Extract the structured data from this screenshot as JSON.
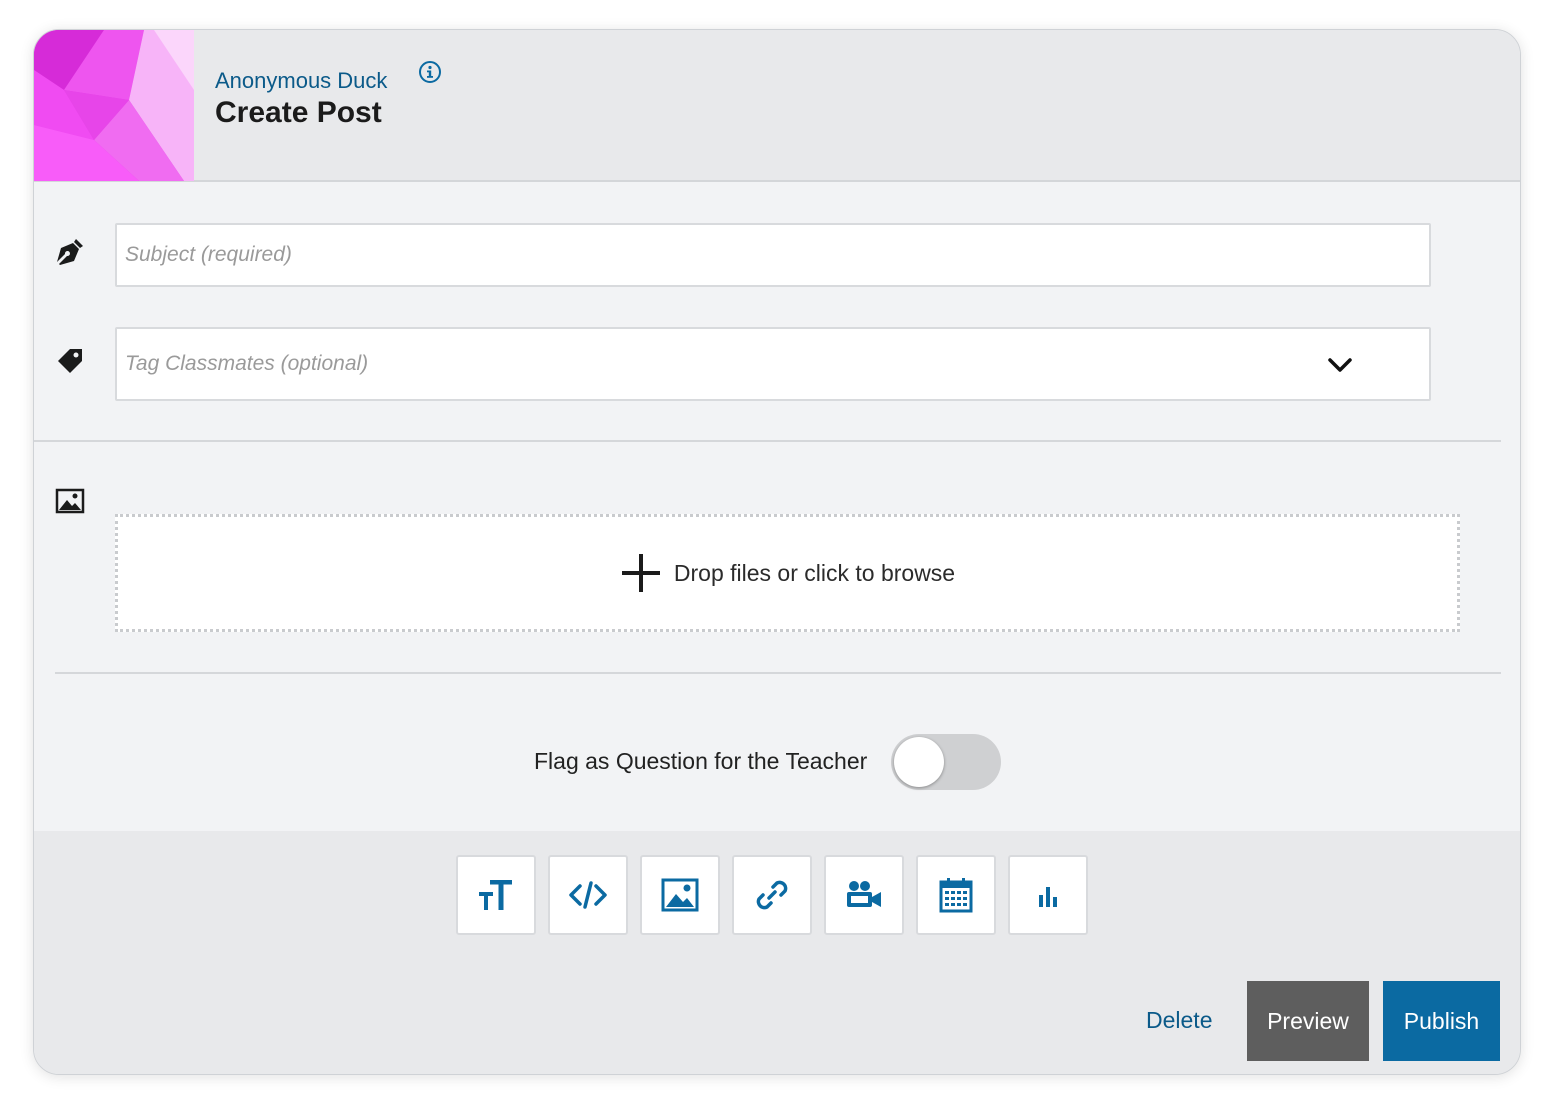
{
  "header": {
    "user_name": "Anonymous Duck",
    "title": "Create Post",
    "info_icon": "info-circle-icon"
  },
  "form": {
    "subject_placeholder": "Subject (required)",
    "subject_value": "",
    "tags_placeholder": "Tag Classmates (optional)",
    "dropzone_label": "Drop files or click to browse",
    "flag_label": "Flag as Question for the Teacher",
    "flag_enabled": false
  },
  "toolbar": {
    "items": [
      {
        "icon": "text-size-icon"
      },
      {
        "icon": "code-icon"
      },
      {
        "icon": "image-icon"
      },
      {
        "icon": "link-icon"
      },
      {
        "icon": "video-camera-icon"
      },
      {
        "icon": "calendar-icon"
      },
      {
        "icon": "bar-chart-icon"
      }
    ]
  },
  "actions": {
    "delete_label": "Delete",
    "preview_label": "Preview",
    "publish_label": "Publish"
  },
  "colors": {
    "accent": "#0b6aa2",
    "link": "#0b5a89",
    "avatar": "#e63ee9",
    "preview_bg": "#5e5e5e"
  }
}
